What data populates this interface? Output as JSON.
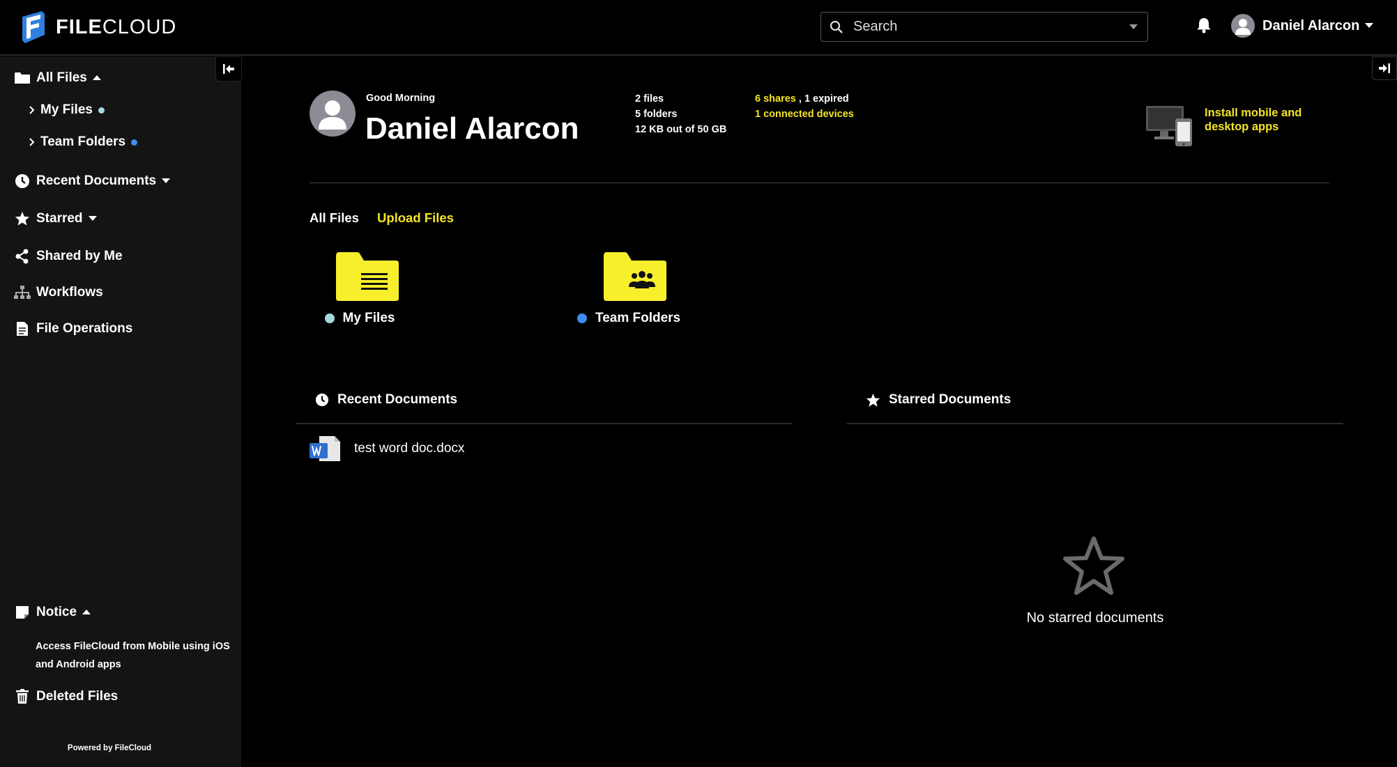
{
  "app": {
    "logo_prefix": "FILE",
    "logo_suffix": "CLOUD"
  },
  "header": {
    "search_placeholder": "Search",
    "user_name": "Daniel Alarcon"
  },
  "sidebar": {
    "all_files": "All Files",
    "my_files": "My Files",
    "team_folders": "Team Folders",
    "recent_documents": "Recent Documents",
    "starred": "Starred",
    "shared_by_me": "Shared by Me",
    "workflows": "Workflows",
    "file_operations": "File Operations",
    "notice": "Notice",
    "notice_text": "Access FileCloud from Mobile using iOS and Android apps",
    "deleted_files": "Deleted Files",
    "powered_by": "Powered by FileCloud"
  },
  "profile": {
    "greeting": "Good Morning",
    "name": "Daniel Alarcon",
    "files": "2 files",
    "folders": "5 folders",
    "storage": "12 KB out of 50 GB",
    "shares": "6 shares",
    "expired": " , 1 expired",
    "devices": "1 connected devices",
    "install_apps": "Install mobile and desktop apps"
  },
  "tabs": {
    "all_files": "All Files",
    "upload_files": "Upload Files"
  },
  "folders": [
    {
      "label": "My Files",
      "dot_color": "#a8d8e0"
    },
    {
      "label": "Team Folders",
      "dot_color": "#3d8ef0"
    }
  ],
  "recent": {
    "title": "Recent Documents",
    "items": [
      {
        "name": "test word doc.docx"
      }
    ]
  },
  "starred": {
    "title": "Starred Documents",
    "empty_text": "No starred documents"
  },
  "colors": {
    "accent_yellow": "#f4e526",
    "my_files_dot": "#a8d8e0",
    "team_dot": "#3d8ef0"
  }
}
